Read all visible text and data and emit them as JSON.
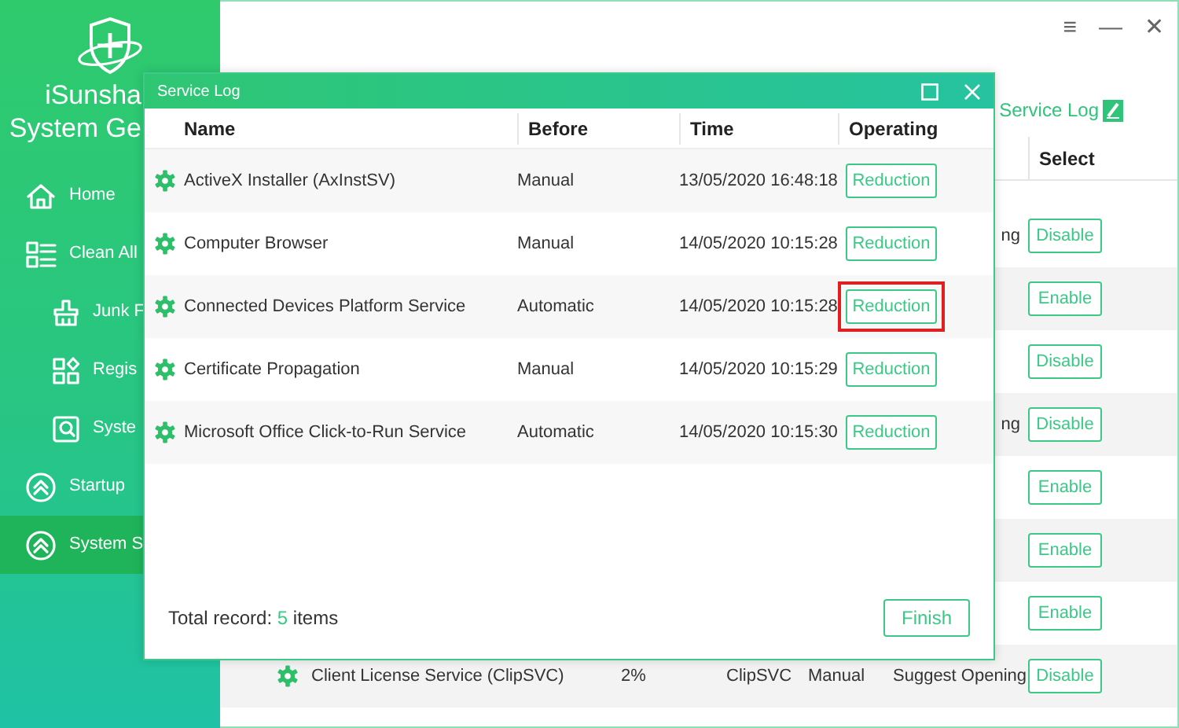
{
  "sidebar": {
    "brand": [
      "iSunsha",
      "System Ge"
    ],
    "items": [
      {
        "label": "Home",
        "sub": false,
        "selected": false
      },
      {
        "label": "Clean All",
        "sub": false,
        "selected": false
      },
      {
        "label": "Junk F",
        "sub": true,
        "selected": false
      },
      {
        "label": "Regis",
        "sub": true,
        "selected": false
      },
      {
        "label": "Syste",
        "sub": true,
        "selected": false
      },
      {
        "label": "Startup",
        "sub": false,
        "selected": false
      },
      {
        "label": "System S",
        "sub": false,
        "selected": true
      }
    ]
  },
  "window_controls": [
    "≡",
    "—",
    "✕"
  ],
  "main": {
    "log_link": "Service Log",
    "select_header": "Select",
    "rows": [
      {
        "kind": "partial",
        "status": "ng",
        "select": "Disable"
      },
      {
        "kind": "partial",
        "select": "Enable"
      },
      {
        "kind": "partial",
        "select": "Disable"
      },
      {
        "kind": "partial",
        "status": "ng",
        "select": "Disable"
      },
      {
        "kind": "partial",
        "select": "Enable"
      },
      {
        "kind": "partial",
        "select": "Enable"
      },
      {
        "kind": "partial",
        "select": "Enable"
      },
      {
        "kind": "full",
        "name": "Client License Service (ClipSVC)",
        "cpu": "2%",
        "service": "ClipSVC",
        "startup": "Manual",
        "status": "Suggest Opening",
        "select": "Disable"
      }
    ]
  },
  "dialog": {
    "title": "Service Log",
    "columns": [
      "Name",
      "Before",
      "Time",
      "Operating"
    ],
    "rows": [
      {
        "name": "ActiveX Installer (AxInstSV)",
        "before": "Manual",
        "time": "13/05/2020 16:48:18",
        "action": "Reduction",
        "highlighted": false
      },
      {
        "name": "Computer Browser",
        "before": "Manual",
        "time": "14/05/2020 10:15:28",
        "action": "Reduction",
        "highlighted": false
      },
      {
        "name": "Connected Devices Platform Service",
        "before": "Automatic",
        "time": "14/05/2020 10:15:28",
        "action": "Reduction",
        "highlighted": true
      },
      {
        "name": "Certificate Propagation",
        "before": "Manual",
        "time": "14/05/2020 10:15:29",
        "action": "Reduction",
        "highlighted": false
      },
      {
        "name": "Microsoft Office Click-to-Run Service",
        "before": "Automatic",
        "time": "14/05/2020 10:15:30",
        "action": "Reduction",
        "highlighted": false
      }
    ],
    "total": "Total record: **5** items",
    "finish": "Finish"
  }
}
